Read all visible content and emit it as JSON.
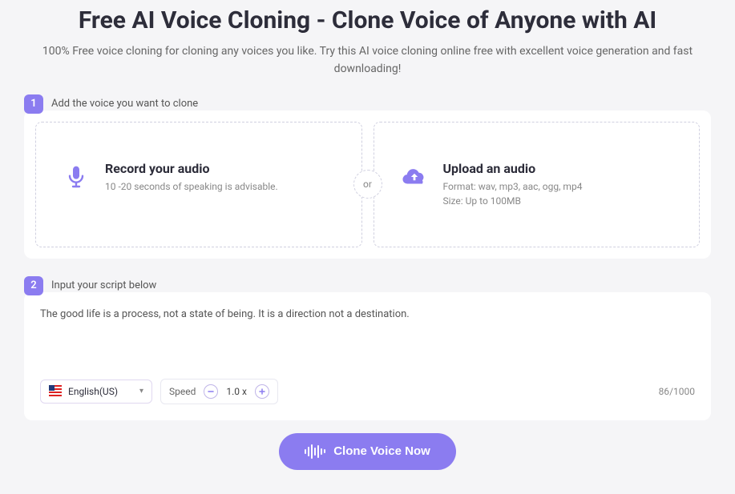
{
  "header": {
    "title": "Free AI Voice Cloning - Clone Voice of Anyone with AI",
    "subtitle": "100% Free voice cloning for cloning any voices you like. Try this AI voice cloning online free with excellent voice generation and fast downloading!"
  },
  "step1": {
    "badge": "1",
    "label": "Add the voice you want to clone",
    "record": {
      "title": "Record your audio",
      "desc": "10 -20 seconds of speaking is advisable."
    },
    "or": "or",
    "upload": {
      "title": "Upload an audio",
      "format": "Format: wav, mp3, aac, ogg, mp4",
      "size": "Size: Up to 100MB"
    }
  },
  "step2": {
    "badge": "2",
    "label": "Input your script below",
    "script": "The good life is a process, not a state of being. It is a direction not a destination.",
    "language": "English(US)",
    "speed_label": "Speed",
    "speed_value": "1.0 x",
    "counter_current": "86",
    "counter_max": "/1000"
  },
  "cta": {
    "label": "Clone Voice Now"
  },
  "colors": {
    "accent": "#8b7cf0"
  }
}
